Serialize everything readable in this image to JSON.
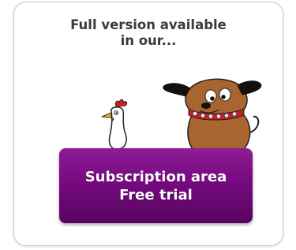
{
  "promo": {
    "headline_line1": "Full version available",
    "headline_line2": "in our...",
    "cta_line1": "Subscription area",
    "cta_line2": "Free trial"
  },
  "colors": {
    "cta_background": "#760a80",
    "cta_text": "#ffffff",
    "headline_text": "#3b3b3b"
  },
  "icons": {
    "chicken": "chicken-illustration",
    "dog": "dog-illustration"
  }
}
